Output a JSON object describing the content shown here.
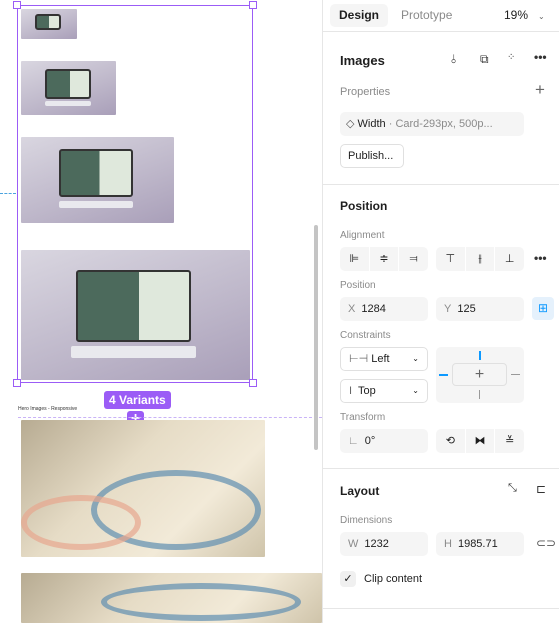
{
  "canvas": {
    "variants_badge": "4 Variants",
    "add_variant": "+",
    "frame_label": "Hero Images - Responsive",
    "accent_color": "#9b5cf6"
  },
  "panel": {
    "tabs": [
      {
        "label": "Design",
        "active": true
      },
      {
        "label": "Prototype",
        "active": false
      }
    ],
    "zoom": "19%",
    "component": {
      "title": "Images",
      "properties_label": "Properties",
      "property_name": "Width",
      "property_value": "· Card-293px, 500p...",
      "publish_label": "Publish..."
    },
    "position": {
      "title": "Position",
      "alignment_label": "Alignment",
      "position_label": "Position",
      "x_label": "X",
      "x": "1284",
      "y_label": "Y",
      "y": "125",
      "constraints_label": "Constraints",
      "h_constraint": "Left",
      "v_constraint": "Top",
      "transform_label": "Transform",
      "rotation": "0°"
    },
    "layout": {
      "title": "Layout",
      "dimensions_label": "Dimensions",
      "w_label": "W",
      "w": "1232",
      "h_label": "H",
      "h": "1985.71",
      "clip_content_label": "Clip content",
      "clip_content": true
    }
  }
}
